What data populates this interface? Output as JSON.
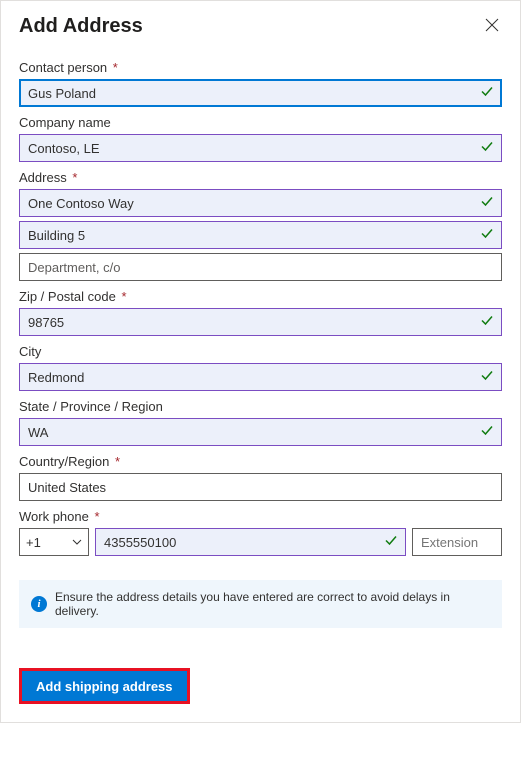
{
  "header": {
    "title": "Add Address"
  },
  "labels": {
    "contact_person": "Contact person",
    "company_name": "Company name",
    "address": "Address",
    "zip": "Zip / Postal code",
    "city": "City",
    "state": "State / Province / Region",
    "country": "Country/Region",
    "work_phone": "Work phone"
  },
  "values": {
    "contact_person": "Gus Poland",
    "company_name": "Contoso, LE",
    "address1": "One Contoso Way",
    "address2": "Building 5",
    "address3_placeholder": "Department, c/o",
    "zip": "98765",
    "city": "Redmond",
    "state": "WA",
    "country": "United States",
    "country_code": "+1",
    "phone": "4355550100",
    "ext_placeholder": "Extension"
  },
  "info": {
    "message": "Ensure the address details you have entered are correct to avoid delays in delivery."
  },
  "buttons": {
    "submit": "Add shipping address"
  }
}
